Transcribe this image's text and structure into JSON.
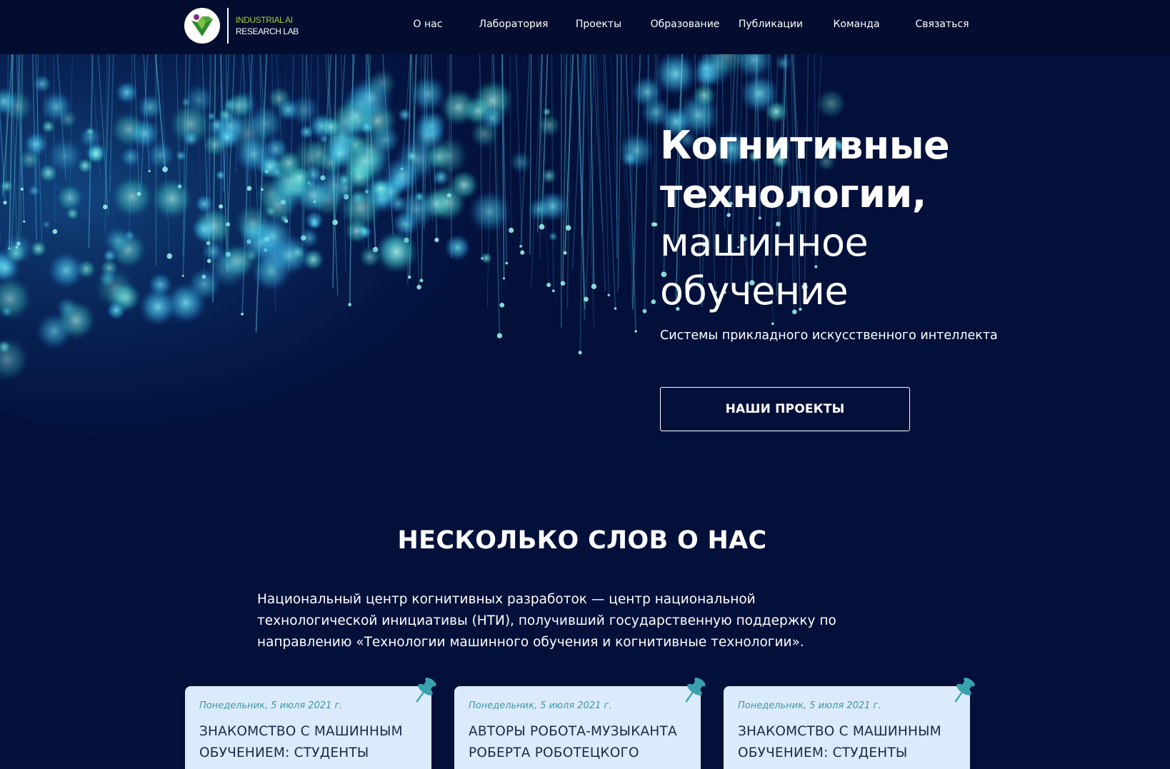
{
  "brand": {
    "line1": "INDUSTRIAL AI",
    "line2": "RESEARCH LAB",
    "accent_color": "#a3cf3e",
    "logo_icon": "gem-leaf-icon"
  },
  "nav": {
    "items": [
      {
        "label": "О нас"
      },
      {
        "label": "Лаборатория"
      },
      {
        "label": "Проекты"
      },
      {
        "label": "Образование"
      },
      {
        "label": "Публикации"
      },
      {
        "label": "Команда"
      },
      {
        "label": "Связаться"
      }
    ]
  },
  "hero": {
    "title_bold_1": "Когнитивные",
    "title_bold_2": "технологии,",
    "title_regular_1": "машинное",
    "title_regular_2": "обучение",
    "subtitle": "Системы прикладного искусственного интеллекта",
    "cta_label": "НАШИ ПРОЕКТЫ"
  },
  "about": {
    "title": "НЕСКОЛЬКО СЛОВ О НАС",
    "text": "Национальный центр когнитивных разработок — центр национальной технологической инициативы (НТИ), получивший государственную поддержку по направлению «Технологии машинного обучения и когнитивные технологии»."
  },
  "news": [
    {
      "date": "Понедельник, 5 июля 2021 г.",
      "title": "ЗНАКОМСТВО С МАШИННЫМ ОБУЧЕНИЕМ: СТУДЕНТЫ",
      "icon": "pushpin-icon"
    },
    {
      "date": "Понедельник, 5 июля 2021 г.",
      "title": "АВТОРЫ РОБОТА-МУЗЫКАНТА РОБЕРТА РОБОТЕЦКОГО",
      "icon": "pushpin-icon"
    },
    {
      "date": "Понедельник, 5 июля 2021 г.",
      "title": "ЗНАКОМСТВО С МАШИННЫМ ОБУЧЕНИЕМ: СТУДЕНТЫ",
      "icon": "pushpin-icon"
    }
  ],
  "colors": {
    "background": "#03103a",
    "header": "#020d2f",
    "card": "#dcebfb",
    "pin": "#3aa2ae"
  }
}
